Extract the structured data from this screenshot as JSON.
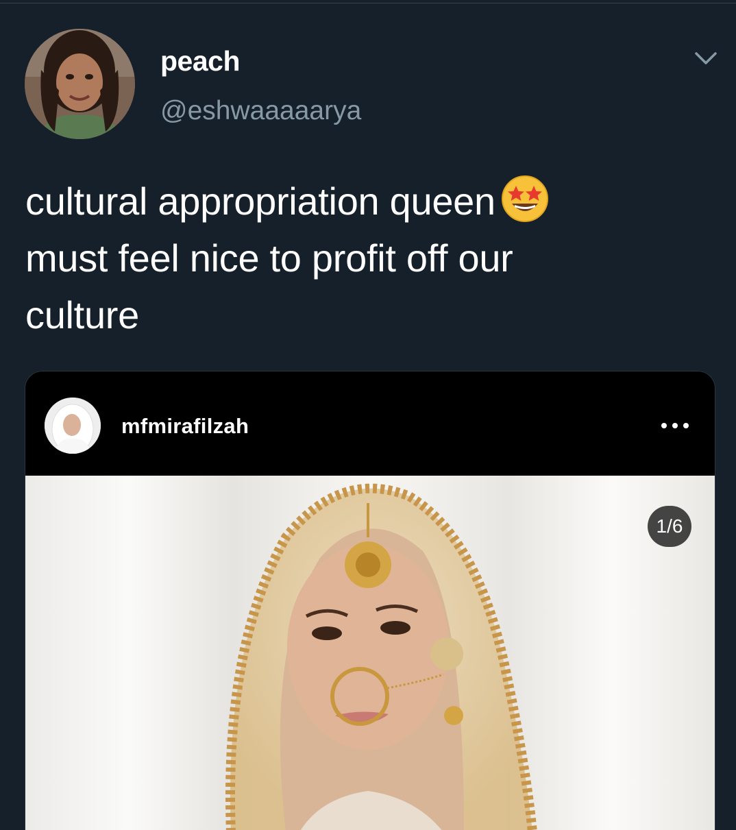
{
  "tweet": {
    "author": {
      "display_name": "peach",
      "handle": "@eshwaaaaarya",
      "avatar_icon": "user-avatar"
    },
    "menu_icon": "chevron-down-icon",
    "text_lines": [
      "cultural appropriation queen",
      "must feel nice to profit off our",
      "culture"
    ],
    "emoji": "star-struck-emoji"
  },
  "embedded_post": {
    "username": "mfmirafilzah",
    "avatar_icon": "user-avatar",
    "menu_icon": "more-dots-icon",
    "image_counter": "1/6"
  },
  "colors": {
    "background": "#15202b",
    "secondary_text": "#8899a6",
    "divider": "#38444d",
    "card_background": "#000000"
  }
}
